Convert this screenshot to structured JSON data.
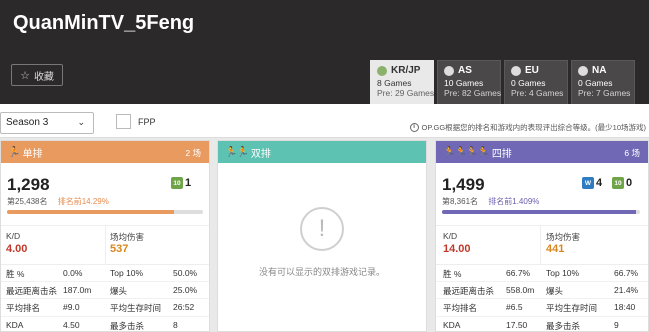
{
  "header": {
    "player_name": "QuanMinTV_5Feng",
    "favorite_label": "收藏",
    "regions": [
      {
        "code": "KR/JP",
        "games": "8 Games",
        "pre": "Pre: 29 Games",
        "active": true
      },
      {
        "code": "AS",
        "games": "10 Games",
        "pre": "Pre: 82 Games",
        "active": false
      },
      {
        "code": "EU",
        "games": "0 Games",
        "pre": "Pre: 4 Games",
        "active": false
      },
      {
        "code": "NA",
        "games": "0 Games",
        "pre": "Pre: 7 Games",
        "active": false
      }
    ]
  },
  "filters": {
    "season": "Season 3",
    "fpp_label": "FPP",
    "info_note": "OP.GG根据您的排名和游戏内的表现评出综合等级。(最少10场游戏)"
  },
  "solo": {
    "title": "单排",
    "games": "2 场",
    "rating": "1,298",
    "rank": "第25,438名",
    "percentile": "排名前14.29%",
    "progress_pct": 85,
    "tier_label": "10",
    "tier_value": "1",
    "kd_label": "K/D",
    "kd": "4.00",
    "dmg_label": "场均伤害",
    "dmg": "537",
    "rows": [
      {
        "l1": "胜 %",
        "v1": "0.0%",
        "l2": "Top 10%",
        "v2": "50.0%"
      },
      {
        "l1": "最远距离击杀",
        "v1": "187.0m",
        "l2": "爆头",
        "v2": "25.0%"
      },
      {
        "l1": "平均排名",
        "v1": "#9.0",
        "l2": "平均生存时间",
        "v2": "26:52"
      },
      {
        "l1": "KDA",
        "v1": "4.50",
        "l2": "最多击杀",
        "v2": "8"
      }
    ]
  },
  "duo": {
    "title": "双排",
    "empty_text": "没有可以显示的双排游戏记录。"
  },
  "squad": {
    "title": "四排",
    "games": "6 场",
    "rating": "1,499",
    "rank": "第8,361名",
    "percentile": "排名前1.409%",
    "progress_pct": 98,
    "win_badge": "W",
    "win_value": "4",
    "tier_label": "10",
    "tier_value": "0",
    "kd_label": "K/D",
    "kd": "14.00",
    "dmg_label": "场均伤害",
    "dmg": "441",
    "rows": [
      {
        "l1": "胜 %",
        "v1": "66.7%",
        "l2": "Top 10%",
        "v2": "66.7%"
      },
      {
        "l1": "最远距离击杀",
        "v1": "558.0m",
        "l2": "爆头",
        "v2": "21.4%"
      },
      {
        "l1": "平均排名",
        "v1": "#6.5",
        "l2": "平均生存时间",
        "v2": "18:40"
      },
      {
        "l1": "KDA",
        "v1": "17.50",
        "l2": "最多击杀",
        "v2": "9"
      }
    ]
  },
  "colors": {
    "solo_accent": "#e99a5f",
    "duo_accent": "#5ec2b3",
    "squad_accent": "#7068b4",
    "kd_red": "#c0392b",
    "dmg_orange": "#d8871e",
    "tier_green": "#6fa548",
    "win_blue": "#2f7cc0"
  }
}
